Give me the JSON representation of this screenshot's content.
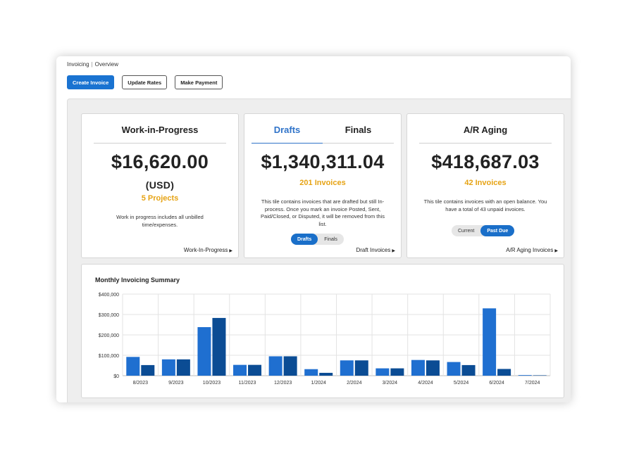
{
  "breadcrumb": {
    "root": "Invoicing",
    "current": "Overview"
  },
  "toolbar": {
    "create_label": "Create Invoice",
    "update_label": "Update Rates",
    "payment_label": "Make Payment"
  },
  "wip": {
    "title": "Work-in-Progress",
    "amount": "$16,620.00",
    "currency": "(USD)",
    "projects": "5 Projects",
    "description": "Work in progress includes all unbilled time/expenses.",
    "link": "Work-In-Progress"
  },
  "drafts": {
    "tab_drafts": "Drafts",
    "tab_finals": "Finals",
    "amount": "$1,340,311.04",
    "count": "201 Invoices",
    "description": "This tile contains invoices that are drafted but still In-process. Once you mark an invoice Posted, Sent, Paid/Closed, or Disputed, it will be removed from this list.",
    "toggle_drafts": "Drafts",
    "toggle_finals": "Finals",
    "link": "Draft Invoices"
  },
  "aging": {
    "title": "A/R Aging",
    "amount": "$418,687.03",
    "count": "42 Invoices",
    "description": "This tile contains invoices with an open balance. You have a total of 43 unpaid invoices.",
    "toggle_current": "Current",
    "toggle_pastdue": "Past Due",
    "link": "A/R Aging Invoices"
  },
  "colors": {
    "accent": "#1a73d1",
    "highlight": "#e6a314",
    "series_light": "#1f6fd0",
    "series_dark": "#0b4c94"
  },
  "chart_data": {
    "type": "bar",
    "title": "Monthly Invoicing Summary",
    "xlabel": "",
    "ylabel": "",
    "ylim": [
      0,
      400000
    ],
    "yticks": [
      "$0",
      "$100,000",
      "$200,000",
      "$300,000",
      "$400,000"
    ],
    "grid": true,
    "categories": [
      "8/2023",
      "9/2023",
      "10/2023",
      "11/2023",
      "12/2023",
      "1/2024",
      "2/2024",
      "3/2024",
      "4/2024",
      "5/2024",
      "6/2024",
      "7/2024"
    ],
    "series": [
      {
        "values": [
          92000,
          80000,
          238000,
          53000,
          95000,
          32000,
          75000,
          36000,
          77000,
          67000,
          330000,
          3000
        ]
      },
      {
        "values": [
          52000,
          80000,
          283000,
          53000,
          95000,
          14000,
          75000,
          36000,
          75000,
          52000,
          33000,
          2000
        ]
      }
    ]
  }
}
